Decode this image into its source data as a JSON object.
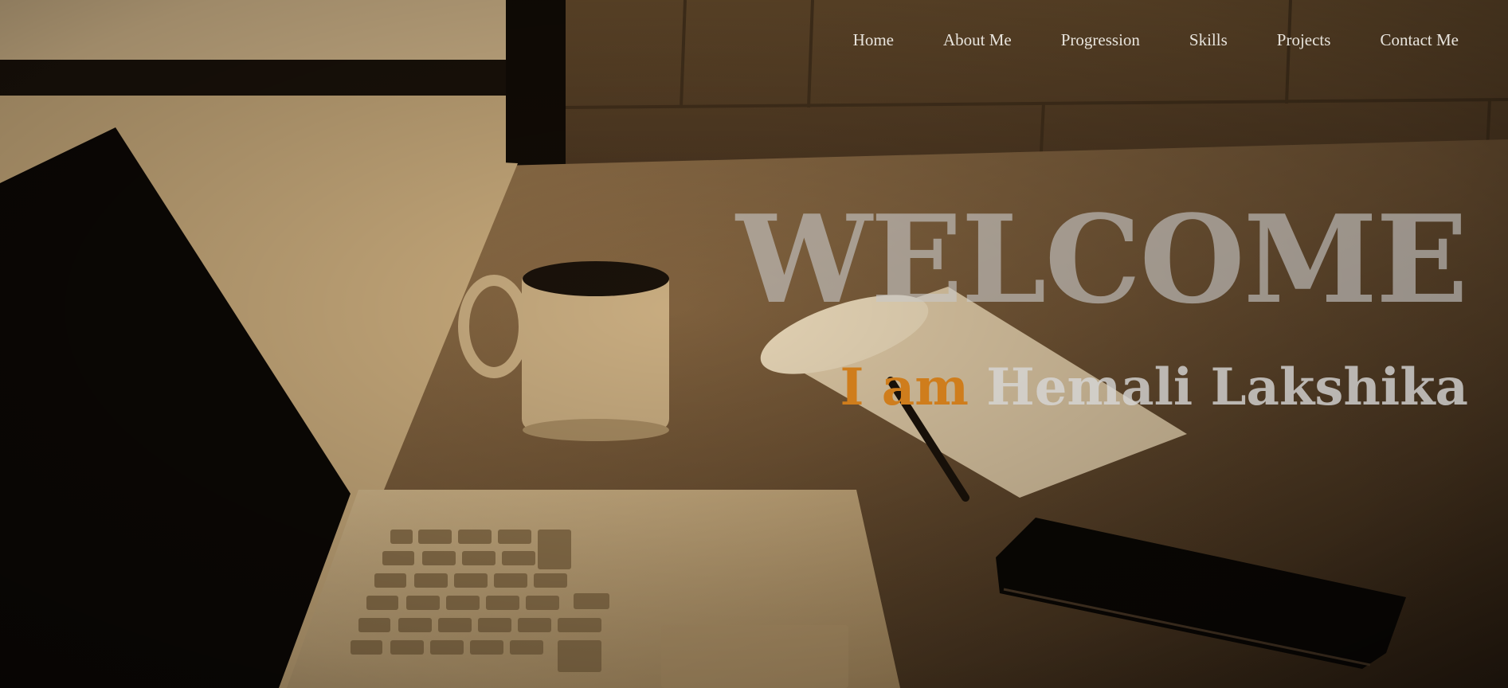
{
  "nav": {
    "items": [
      {
        "label": "Home"
      },
      {
        "label": "About Me"
      },
      {
        "label": "Progression"
      },
      {
        "label": "Skills"
      },
      {
        "label": "Projects"
      },
      {
        "label": "Contact Me"
      }
    ]
  },
  "hero": {
    "heading": "WELCOME",
    "intro_lead": "I am",
    "intro_name": "Hemali Lakshika"
  },
  "colors": {
    "accent": "#cf7d1c",
    "nav_text": "#e8e4dc",
    "heading_text": "#c8c8c8",
    "sepia_tone": "#8a6a44"
  },
  "background": {
    "description_icon": "desk-workspace-photo"
  }
}
